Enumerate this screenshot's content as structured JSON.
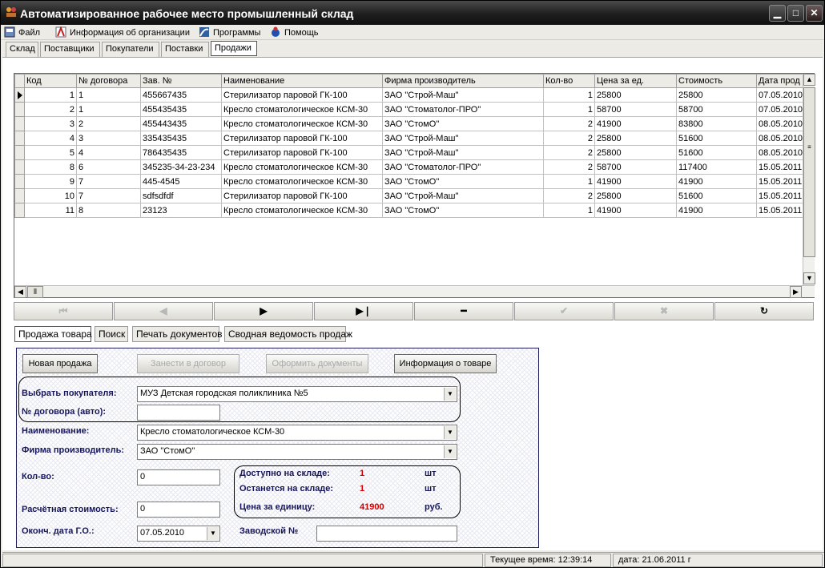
{
  "window": {
    "title": "Автоматизированное рабочее место промышленный склад",
    "controls": [
      "minimize",
      "maximize",
      "close"
    ]
  },
  "menu": [
    {
      "label": "Файл",
      "icon": "file-icon"
    },
    {
      "label": "Информация об организации",
      "icon": "organization-icon"
    },
    {
      "label": "Программы",
      "icon": "programs-icon"
    },
    {
      "label": "Помощь",
      "icon": "help-icon"
    }
  ],
  "tabs": [
    "Склад",
    "Поставщики",
    "Покупатели",
    "Поставки",
    "Продажи"
  ],
  "active_tab": "Продажи",
  "grid": {
    "columns": [
      "Код",
      "№ договора",
      "Зав. №",
      "Наименование",
      "Фирма производитель",
      "Кол-во",
      "Цена за ед.",
      "Стоимость",
      "Дата прод"
    ],
    "rows": [
      [
        "1",
        "1",
        "455667435",
        "Стерилизатор паровой ГК-100",
        "ЗАО \"Строй-Маш\"",
        "1",
        "25800",
        "25800",
        "07.05.2010"
      ],
      [
        "2",
        "1",
        "455435435",
        "Кресло стоматологическое КСМ-30",
        "ЗАО \"Стоматолог-ПРО\"",
        "1",
        "58700",
        "58700",
        "07.05.2010"
      ],
      [
        "3",
        "2",
        "455443435",
        "Кресло стоматологическое КСМ-30",
        "ЗАО \"СтомО\"",
        "2",
        "41900",
        "83800",
        "08.05.2010"
      ],
      [
        "4",
        "3",
        "335435435",
        "Стерилизатор паровой ГК-100",
        "ЗАО \"Строй-Маш\"",
        "2",
        "25800",
        "51600",
        "08.05.2010"
      ],
      [
        "5",
        "4",
        "786435435",
        "Стерилизатор паровой ГК-100",
        "ЗАО \"Строй-Маш\"",
        "2",
        "25800",
        "51600",
        "08.05.2010"
      ],
      [
        "8",
        "6",
        "345235-34-23-234",
        "Кресло стоматологическое КСМ-30",
        "ЗАО \"Стоматолог-ПРО\"",
        "2",
        "58700",
        "117400",
        "15.05.2011"
      ],
      [
        "9",
        "7",
        "445-4545",
        "Кресло стоматологическое КСМ-30",
        "ЗАО \"СтомО\"",
        "1",
        "41900",
        "41900",
        "15.05.2011"
      ],
      [
        "10",
        "7",
        "sdfsdfdf",
        "Стерилизатор паровой ГК-100",
        "ЗАО \"Строй-Маш\"",
        "2",
        "25800",
        "51600",
        "15.05.2011"
      ],
      [
        "11",
        "8",
        "23123",
        "Кресло стоматологическое КСМ-30",
        "ЗАО \"СтомО\"",
        "1",
        "41900",
        "41900",
        "15.05.2011"
      ]
    ]
  },
  "navigator": [
    {
      "name": "first-record-button",
      "glyph": "⏮",
      "enabled": false
    },
    {
      "name": "prior-record-button",
      "glyph": "◀",
      "enabled": false
    },
    {
      "name": "next-record-button",
      "glyph": "▶",
      "enabled": true
    },
    {
      "name": "last-record-button",
      "glyph": "▶❘",
      "enabled": true
    },
    {
      "name": "delete-record-button",
      "glyph": "━",
      "enabled": true
    },
    {
      "name": "post-record-button",
      "glyph": "✔",
      "enabled": false
    },
    {
      "name": "cancel-record-button",
      "glyph": "✖",
      "enabled": false
    },
    {
      "name": "refresh-button",
      "glyph": "↻",
      "enabled": true
    }
  ],
  "subtabs": [
    "Продажа товара",
    "Поиск",
    "Печать документов",
    "Сводная ведомость продаж"
  ],
  "form": {
    "new_sale": "Новая продажа",
    "add_to_contract": "Занести в договор",
    "make_documents": "Оформить документы",
    "product_info": "Информация о товаре",
    "buyer_label": "Выбрать покупателя:",
    "buyer_value": "МУЗ Детская городская поликлиника №5",
    "contract_label": "№ договора (авто):",
    "contract_value": "",
    "name_label": "Наименование:",
    "name_value": "Кресло стоматологическое КСМ-30",
    "firm_label": "Фирма производитель:",
    "firm_value": "ЗАО \"СтомО\"",
    "qty_label": "Кол-во:",
    "qty_value": "0",
    "cost_label": "Расчётная стоимость:",
    "cost_value": "0",
    "enddate_label": "Оконч. дата Г.О.:",
    "enddate_value": "07.05.2010",
    "serial_label": "Заводской №",
    "serial_value": "",
    "available_label": "Доступно на складе:",
    "available_value": "1",
    "available_unit": "шт",
    "remain_label": "Останется на складе:",
    "remain_value": "1",
    "remain_unit": "шт",
    "price_label": "Цена за единицу:",
    "price_value": "41900",
    "price_unit": "руб."
  },
  "status": {
    "time": "Текущее время: 12:39:14",
    "date": "дата: 21.06.2011 г"
  }
}
